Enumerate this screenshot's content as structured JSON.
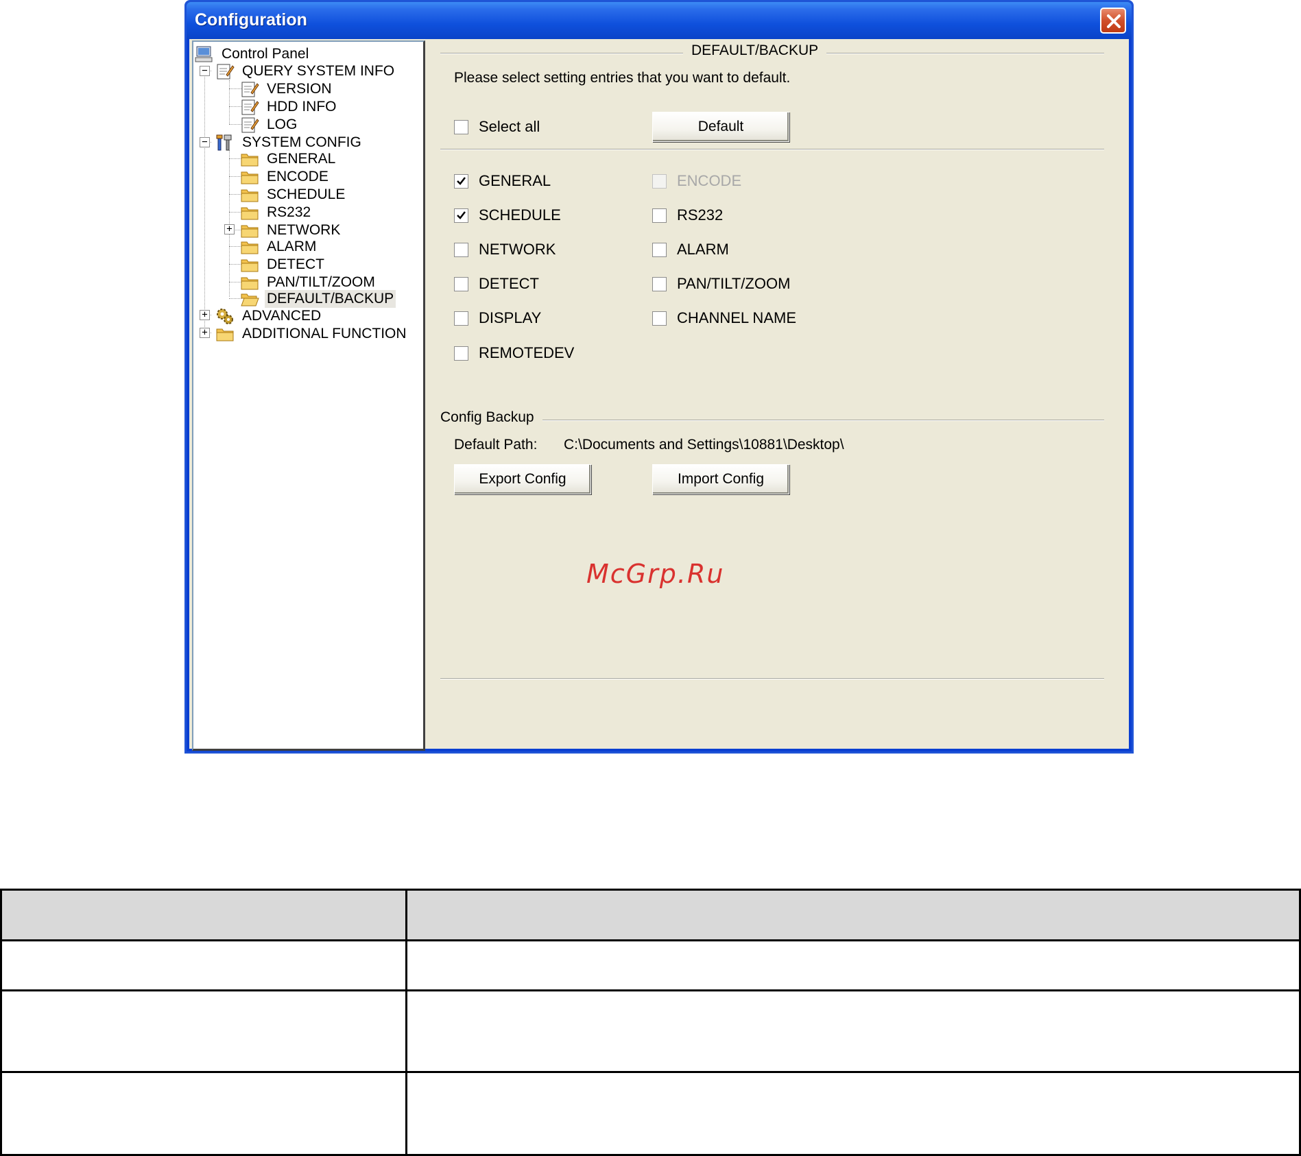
{
  "window": {
    "title": "Configuration"
  },
  "tree": {
    "root": "Control Panel",
    "query_system_info": {
      "label": "QUERY SYSTEM INFO",
      "expander": "−",
      "children": [
        "VERSION",
        "HDD INFO",
        "LOG"
      ]
    },
    "system_config": {
      "label": "SYSTEM CONFIG",
      "expander": "−",
      "children": [
        "GENERAL",
        "ENCODE",
        "SCHEDULE",
        "RS232",
        "NETWORK",
        "ALARM",
        "DETECT",
        "PAN/TILT/ZOOM",
        "DEFAULT/BACKUP"
      ],
      "network_expander": "+"
    },
    "advanced": {
      "label": "ADVANCED",
      "expander": "+"
    },
    "additional_function": {
      "label": "ADDITIONAL FUNCTION",
      "expander": "+"
    },
    "selected": "DEFAULT/BACKUP"
  },
  "panel": {
    "group_title": "DEFAULT/BACKUP",
    "instruction": "Please select setting entries that you want to default.",
    "select_all": {
      "label": "Select all",
      "checked": false
    },
    "default_button": "Default",
    "entries_left": [
      {
        "label": "GENERAL",
        "checked": true
      },
      {
        "label": "SCHEDULE",
        "checked": true
      },
      {
        "label": "NETWORK",
        "checked": false
      },
      {
        "label": "DETECT",
        "checked": false
      },
      {
        "label": "DISPLAY",
        "checked": false
      },
      {
        "label": "REMOTEDEV",
        "checked": false
      }
    ],
    "entries_right": [
      {
        "label": "ENCODE",
        "checked": false,
        "disabled": true
      },
      {
        "label": "RS232",
        "checked": false
      },
      {
        "label": "ALARM",
        "checked": false
      },
      {
        "label": "PAN/TILT/ZOOM",
        "checked": false
      },
      {
        "label": "CHANNEL NAME",
        "checked": false
      }
    ],
    "config_backup": {
      "title": "Config Backup",
      "default_path_label": "Default Path:",
      "default_path_value": "C:\\Documents and Settings\\10881\\Desktop\\",
      "export_button": "Export Config",
      "import_button": "Import Config"
    },
    "watermark": "McGrp.Ru"
  },
  "icons": {
    "root": "computer-icon",
    "query_system_info": "notepad-icon",
    "system_config": "tools-icon",
    "folder": "folder-icon",
    "advanced": "gears-icon",
    "close": "close-icon"
  },
  "colors": {
    "titlebar": "#0f50dc",
    "dialog_bg": "#ece9d8",
    "close_button": "#d0502b",
    "folder": "#f2c24e",
    "watermark": "#d9322f",
    "table_header": "#d9d9d9"
  }
}
